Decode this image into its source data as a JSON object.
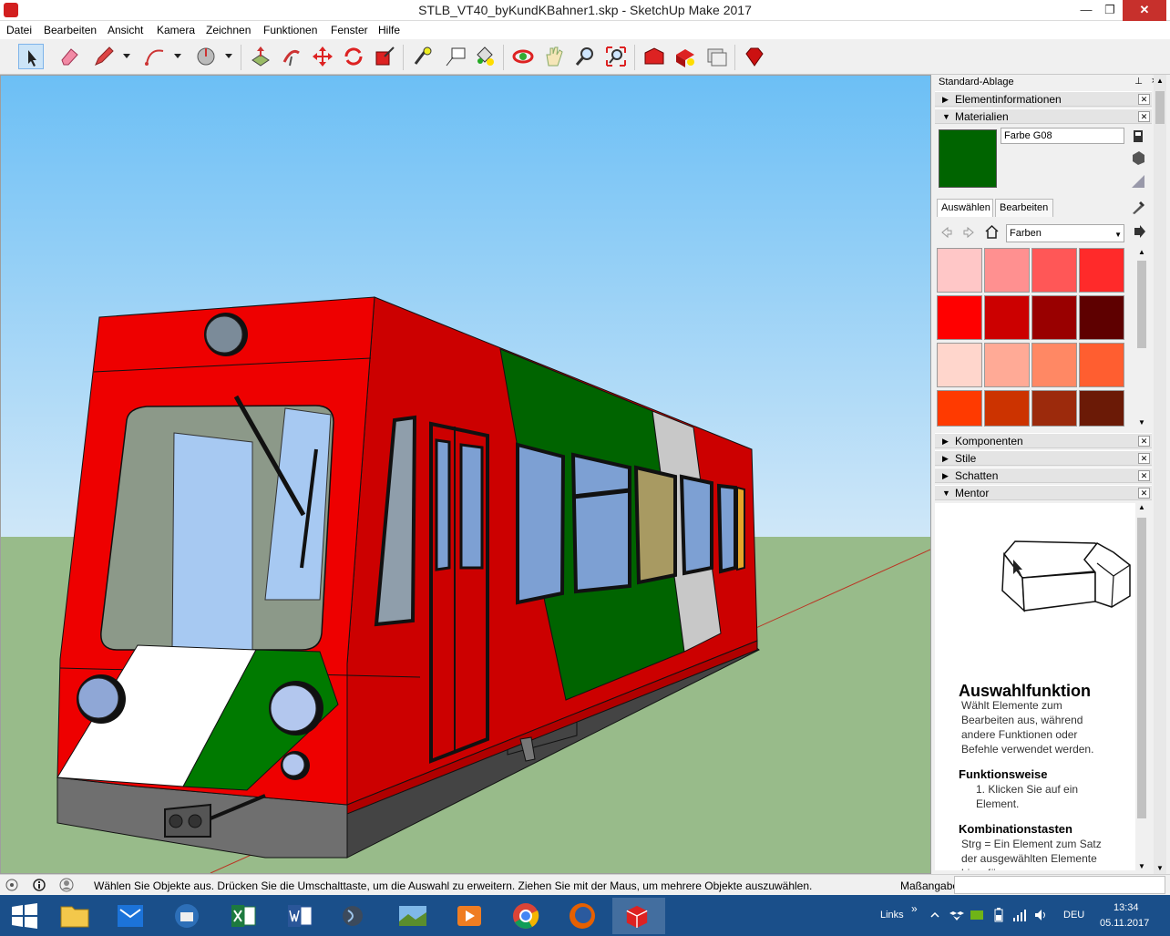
{
  "window": {
    "title": "STLB_VT40_byKundKBahner1.skp - SketchUp Make 2017",
    "minimize": "—",
    "maximize": "❐",
    "close": "✕"
  },
  "menu": [
    "Datei",
    "Bearbeiten",
    "Ansicht",
    "Kamera",
    "Zeichnen",
    "Funktionen",
    "Fenster",
    "Hilfe"
  ],
  "toolbar": {
    "tools": [
      "select-icon",
      "eraser-icon",
      "pencil-icon",
      "arc-icon",
      "pie-icon",
      "push-pull-icon",
      "follow-me-icon",
      "move-icon",
      "rotate-icon",
      "scale-icon",
      "tape-measure-icon",
      "text-icon",
      "paint-bucket-icon",
      "orbit-icon",
      "pan-icon",
      "zoom-icon",
      "zoom-extents-icon",
      "warehouse-icon",
      "extension-icon",
      "share-icon",
      "ruby-icon"
    ]
  },
  "tray": {
    "title": "Standard-Ablage",
    "pin": "⊥",
    "close": "×",
    "panels": {
      "entity_info": "Elementinformationen",
      "materials": "Materialien",
      "components": "Komponenten",
      "styles": "Stile",
      "shadows": "Schatten",
      "mentor": "Mentor"
    },
    "material": {
      "name": "Farbe G08",
      "color": "#006400",
      "tab_select": "Auswählen",
      "tab_edit": "Bearbeiten",
      "library": "Farben",
      "swatches": [
        "#ffc7c7",
        "#ff9090",
        "#ff5757",
        "#ff2a2a",
        "#ff0000",
        "#cc0000",
        "#990000",
        "#5e0000",
        "#ffd6cc",
        "#ffaa96",
        "#ff8864",
        "#ff5e30",
        "#ff3a00",
        "#cc3300",
        "#9c2a0c",
        "#6b1a06"
      ]
    },
    "mentor": {
      "heading": "Auswahlfunktion",
      "description": "Wählt Elemente zum Bearbeiten aus, während andere Funktionen oder Befehle verwendet werden.",
      "section1": "Funktionsweise",
      "step1": "1. Klicken Sie auf ein Element.",
      "section2": "Kombinationstasten",
      "combo1": "Strg = Ein Element zum Satz der ausgewählten Elemente hinzufügen"
    }
  },
  "status": {
    "text": "Wählen Sie Objekte aus. Drücken Sie die Umschalttaste, um die Auswahl zu erweitern. Ziehen Sie mit der Maus, um mehrere Objekte auszuwählen.",
    "measure_label": "Maßangaben",
    "measure_value": ""
  },
  "taskbar": {
    "apps": [
      "start-icon",
      "file-explorer-icon",
      "mail-icon",
      "thunderbird-icon",
      "excel-icon",
      "word-icon",
      "app-icon",
      "photos-icon",
      "media-player-icon",
      "chrome-icon",
      "firefox-icon",
      "sketchup-icon"
    ],
    "links": "Links",
    "language": "DEU",
    "time": "13:34",
    "date": "05.11.2017"
  }
}
